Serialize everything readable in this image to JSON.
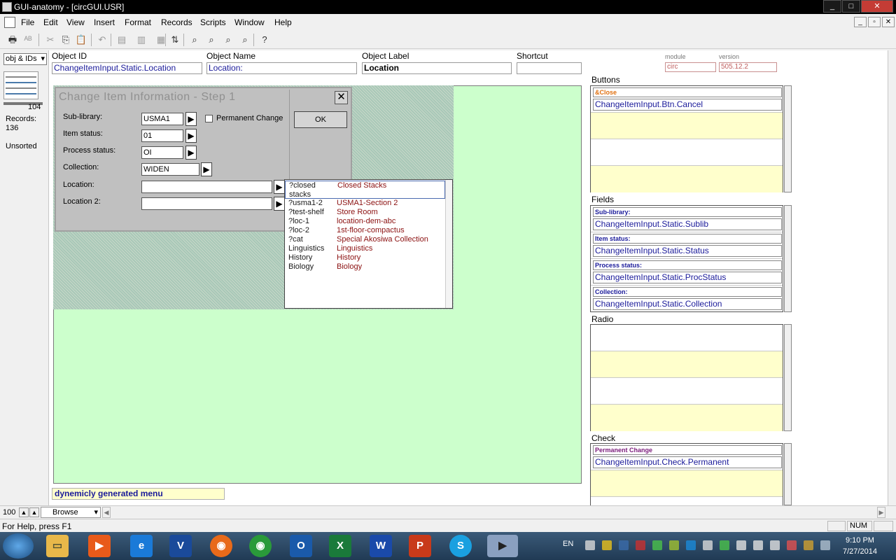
{
  "window": {
    "title": "GUI-anatomy - [circGUI.USR]",
    "minimize": "_",
    "maximize": "□",
    "close": "✕"
  },
  "menu": [
    "File",
    "Edit",
    "View",
    "Insert",
    "Format",
    "Records",
    "Scripts",
    "Window",
    "Help"
  ],
  "mdi_controls": {
    "minimize": "_",
    "restore": "▫",
    "close": "✕"
  },
  "left_panel": {
    "layout": "obj & IDs",
    "record_count": "104",
    "records_label": "Records:",
    "records_value": "136",
    "sort_status": "Unsorted"
  },
  "header": {
    "object_id_label": "Object ID",
    "object_id_value": "ChangeItemInput.Static.Location",
    "object_name_label": "Object Name",
    "object_name_value": "Location:",
    "object_label_label": "Object Label",
    "object_label_value": "Location",
    "shortcut_label": "Shortcut",
    "shortcut_value": "",
    "module_label": "module",
    "module_value": "circ",
    "version_label": "version",
    "version_value": "505.12.2"
  },
  "dialog": {
    "title": "Change Item Information - Step 1",
    "close": "✕",
    "sub_library_label": "Sub-library:",
    "sub_library_value": "USMA1",
    "item_status_label": "Item status:",
    "item_status_value": "01",
    "process_status_label": "Process status:",
    "process_status_value": "OI",
    "collection_label": "Collection:",
    "collection_value": "WIDEN",
    "location_label": "Location:",
    "location_value": "",
    "location2_label": "Location 2:",
    "location2_value": "",
    "permanent_label": "Permanent Change",
    "ok_label": "OK"
  },
  "dropdown": [
    {
      "code": "?closed",
      "code2": "stacks",
      "name": "Closed Stacks"
    },
    {
      "code": "?usma1-2",
      "name": "USMA1-Section 2"
    },
    {
      "code": "?test-shelf",
      "name": "Store Room"
    },
    {
      "code": "?loc-1",
      "name": "location-dem-abc"
    },
    {
      "code": "?loc-2",
      "name": "1st-floor-compactus"
    },
    {
      "code": "?cat",
      "name": "Special Akosiwa Collection"
    },
    {
      "code": "Linguistics",
      "name": "Linguistics"
    },
    {
      "code": "History",
      "name": "History"
    },
    {
      "code": "Biology",
      "name": "Biology"
    }
  ],
  "status_note": "dynemicly generated menu",
  "buttons_panel": {
    "title": "Buttons",
    "items": [
      {
        "label": "&Close",
        "value": "ChangeItemInput.Btn.Cancel"
      }
    ]
  },
  "fields_panel": {
    "title": "Fields",
    "items": [
      {
        "label": "Sub-library:",
        "value": "ChangeItemInput.Static.Sublib"
      },
      {
        "label": "Item status:",
        "value": "ChangeItemInput.Static.Status"
      },
      {
        "label": "Process status:",
        "value": "ChangeItemInput.Static.ProcStatus"
      },
      {
        "label": "Collection:",
        "value": "ChangeItemInput.Static.Collection"
      }
    ]
  },
  "radio_panel": {
    "title": "Radio"
  },
  "check_panel": {
    "title": "Check",
    "items": [
      {
        "label": "Permanent Change",
        "value": "ChangeItemInput.Check.Permanent"
      }
    ]
  },
  "bottom_bar": {
    "zoom": "100",
    "mode": "Browse"
  },
  "status_bar": {
    "help": "For Help, press F1",
    "num": "NUM"
  },
  "taskbar": {
    "lang": "EN",
    "time": "9:10 PM",
    "date": "7/27/2014"
  }
}
